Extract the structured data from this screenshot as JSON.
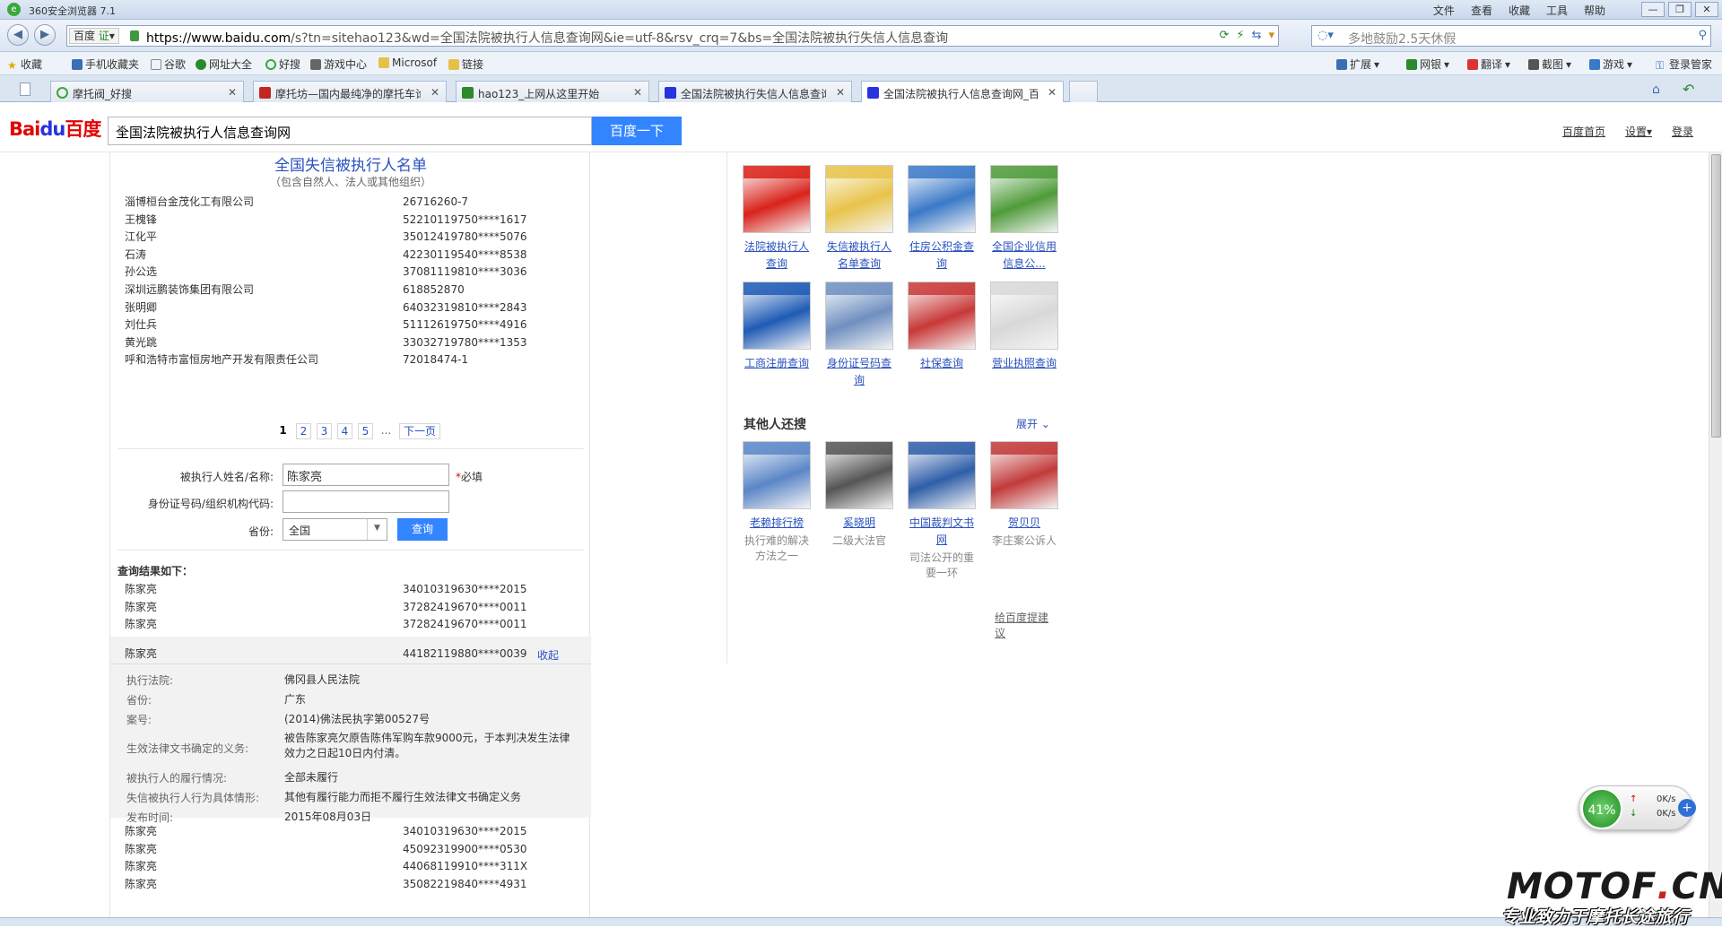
{
  "browser": {
    "title": "360安全浏览器 7.1",
    "menus": [
      "文件",
      "查看",
      "收藏",
      "工具",
      "帮助"
    ],
    "window_buttons": [
      "—",
      "❐",
      "✕"
    ],
    "engine_label": "百度",
    "cert_label": "证",
    "url_host": "https://www.baidu.com",
    "url_rest": "/s?tn=sitehao123&wd=全国法院被执行人信息查询网&ie=utf-8&rsv_crq=7&bs=全国法院被执行失信人信息查询",
    "search_placeholder": "多地鼓励2.5天休假",
    "login_label": "登录管家"
  },
  "favorites": [
    "收藏",
    "手机收藏夹",
    "谷歌",
    "网址大全",
    "好搜",
    "游戏中心",
    "Microsof",
    "链接"
  ],
  "favbar_right": [
    "扩展",
    "网银",
    "翻译",
    "截图",
    "游戏"
  ],
  "tabs": [
    {
      "label": "摩托阀_好搜",
      "icon_color": "#3aa83a"
    },
    {
      "label": "摩托坊—国内最纯净的摩托车论坛",
      "icon_color": "#c2261f"
    },
    {
      "label": "hao123_上网从这里开始",
      "icon_color": "#2b8a2b"
    },
    {
      "label": "全国法院被执行失信人信息查询",
      "icon_color": "#2932e1"
    },
    {
      "label": "全国法院被执行人信息查询网_百度搜索",
      "icon_color": "#2932e1"
    }
  ],
  "baidu": {
    "logo_a": "Bai",
    "logo_b": "du",
    "logo_c": "百度",
    "query": "全国法院被执行人信息查询网",
    "clear": "✕",
    "search_button": "百度一下",
    "links": [
      "百度首页",
      "设置▾",
      "登录"
    ]
  },
  "card": {
    "title": "全国失信被执行人名单",
    "subtitle": "（包含自然人、法人或其他组织）",
    "list": [
      {
        "name": "淄博桓台金茂化工有限公司",
        "id": "26716260-7"
      },
      {
        "name": "王槐锋",
        "id": "52210119750****1617"
      },
      {
        "name": "江化平",
        "id": "35012419780****5076"
      },
      {
        "name": "石涛",
        "id": "42230119540****8538"
      },
      {
        "name": "孙公选",
        "id": "37081119810****3036"
      },
      {
        "name": "深圳远鹏装饰集团有限公司",
        "id": "618852870"
      },
      {
        "name": "张明卿",
        "id": "64032319810****2843"
      },
      {
        "name": "刘仕兵",
        "id": "51112619750****4916"
      },
      {
        "name": "黄光跳",
        "id": "33032719780****1353"
      },
      {
        "name": "呼和浩特市富恒房地产开发有限责任公司",
        "id": "72018474-1"
      }
    ],
    "pager": {
      "current": "1",
      "pages": [
        "2",
        "3",
        "4",
        "5"
      ],
      "dots": "...",
      "next": "下一页"
    },
    "form": {
      "name_label": "被执行人姓名/名称:",
      "name_value": "陈家亮",
      "required_mark": "*",
      "required_text": "必填",
      "id_label": "身份证号码/组织机构代码:",
      "id_value": "",
      "province_label": "省份:",
      "province_value": "全国",
      "submit": "查询"
    },
    "results_title": "查询结果如下：",
    "results_top": [
      {
        "name": "陈家亮",
        "id": "34010319630****2015"
      },
      {
        "name": "陈家亮",
        "id": "37282419670****0011"
      },
      {
        "name": "陈家亮",
        "id": "37282419670****0011"
      }
    ],
    "expanded": {
      "name": "陈家亮",
      "id": "44182119880****0039",
      "collapse": "收起"
    },
    "detail": [
      {
        "label": "执行法院:",
        "value": "佛冈县人民法院"
      },
      {
        "label": "省份:",
        "value": "广东"
      },
      {
        "label": "案号:",
        "value": "(2014)佛法民执字第00527号"
      },
      {
        "label": "生效法律文书确定的义务:",
        "value": "被告陈家亮欠原告陈伟军购车款9000元，于本判决发生法律效力之日起10日内付清。"
      },
      {
        "label": "被执行人的履行情况:",
        "value": "全部未履行"
      },
      {
        "label": "失信被执行人行为具体情形:",
        "value": "其他有履行能力而拒不履行生效法律文书确定义务"
      },
      {
        "label": "发布时间:",
        "value": "2015年08月03日"
      }
    ],
    "results_bottom": [
      {
        "name": "陈家亮",
        "id": "34010319630****2015"
      },
      {
        "name": "陈家亮",
        "id": "45092319900****0530"
      },
      {
        "name": "陈家亮",
        "id": "44068119910****311X"
      },
      {
        "name": "陈家亮",
        "id": "35082219840****4931"
      }
    ]
  },
  "right": {
    "grid": [
      {
        "label": "法院被执行人查询",
        "color": "#d9221a"
      },
      {
        "label": "失信被执行人名单查询",
        "color": "#e8c34a"
      },
      {
        "label": "住房公积金查询",
        "color": "#3a79c8"
      },
      {
        "label": "全国企业信用信息公...",
        "color": "#4f9b3a"
      },
      {
        "label": "工商注册查询",
        "color": "#1f5bb5"
      },
      {
        "label": "身份证号码查询",
        "color": "#6f8fbf"
      },
      {
        "label": "社保查询",
        "color": "#c83838"
      },
      {
        "label": "营业执照查询",
        "color": "#d8d8d8"
      }
    ],
    "others_title": "其他人还搜",
    "expand": "展开",
    "others": [
      {
        "label": "老赖排行榜",
        "desc": "执行难的解决方法之一",
        "color": "#5a86c7"
      },
      {
        "label": "奚晓明",
        "desc": "二级大法官",
        "color": "#555555"
      },
      {
        "label": "中国裁判文书网",
        "desc": "司法公开的重要一环",
        "color": "#2f5ea8"
      },
      {
        "label": "贺贝贝",
        "desc": "李庄案公诉人",
        "color": "#c23a3a"
      }
    ],
    "feedback": "给百度提建议"
  },
  "speed": {
    "percent": "41%",
    "up": "0K/s",
    "down": "0K/s",
    "plus": "+"
  },
  "watermark": {
    "brand_a": "MOTOF",
    "brand_dot": ".",
    "brand_b": "CN",
    "slogan": "专业致力于摩托长途旅行"
  }
}
